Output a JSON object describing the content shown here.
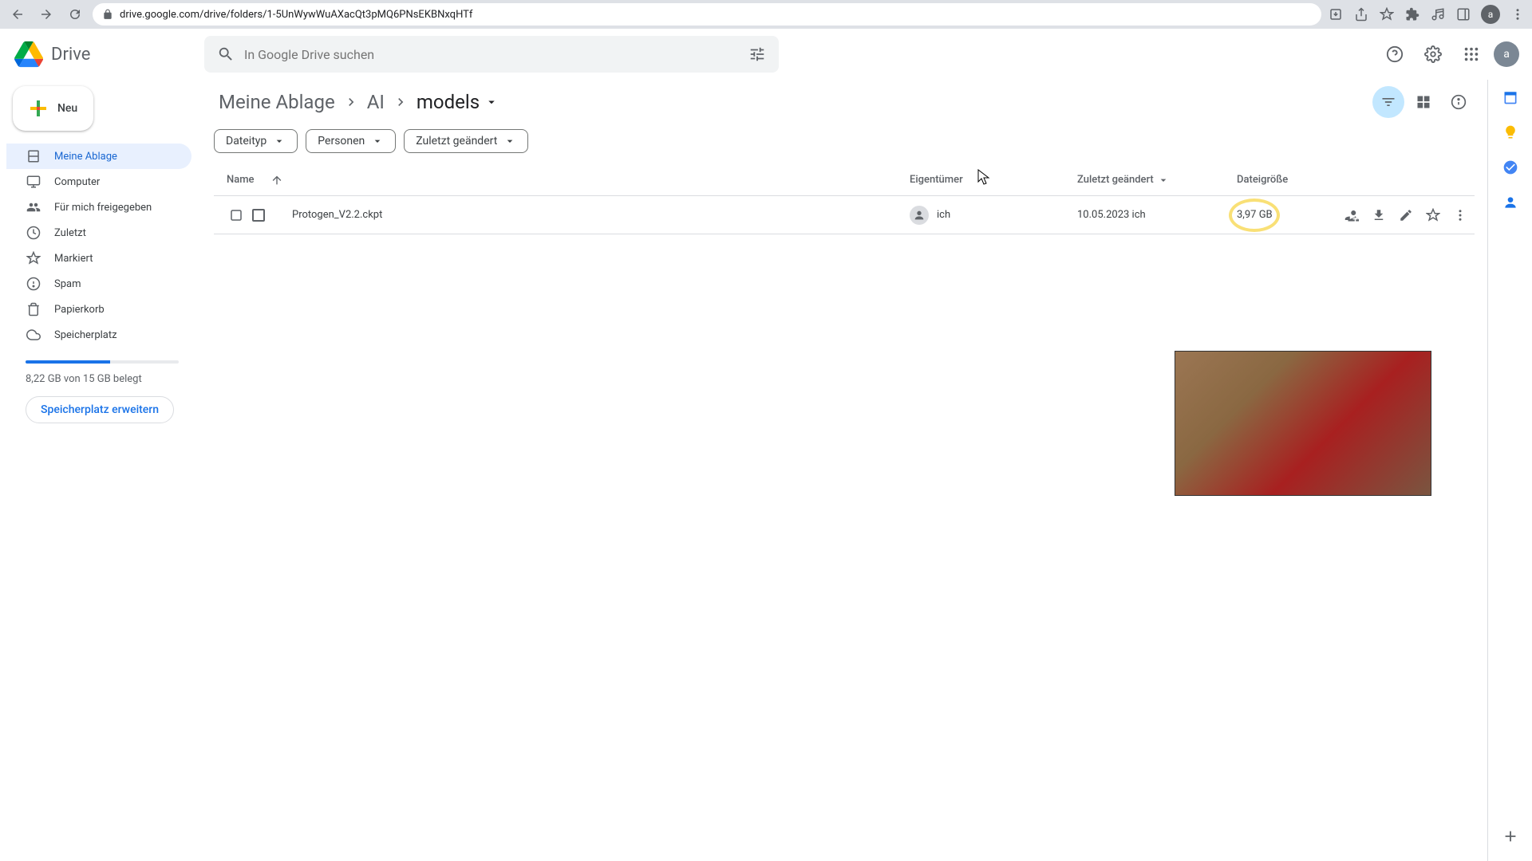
{
  "browser": {
    "url": "drive.google.com/drive/folders/1-5UnWywWuAXacQt3pMQ6PNsEKBNxqHTf"
  },
  "header": {
    "app_name": "Drive",
    "search_placeholder": "In Google Drive suchen",
    "avatar_letter": "a"
  },
  "sidebar": {
    "new_label": "Neu",
    "items": [
      {
        "label": "Meine Ablage"
      },
      {
        "label": "Computer"
      },
      {
        "label": "Für mich freigegeben"
      },
      {
        "label": "Zuletzt"
      },
      {
        "label": "Markiert"
      },
      {
        "label": "Spam"
      },
      {
        "label": "Papierkorb"
      },
      {
        "label": "Speicherplatz"
      }
    ],
    "storage_text": "8,22 GB von 15 GB belegt",
    "upgrade_label": "Speicherplatz erweitern"
  },
  "breadcrumb": {
    "items": [
      "Meine Ablage",
      "AI",
      "models"
    ]
  },
  "filters": [
    {
      "label": "Dateityp"
    },
    {
      "label": "Personen"
    },
    {
      "label": "Zuletzt geändert"
    }
  ],
  "table": {
    "headers": {
      "name": "Name",
      "owner": "Eigentümer",
      "modified": "Zuletzt geändert",
      "size": "Dateigröße"
    },
    "rows": [
      {
        "name": "Protogen_V2.2.ckpt",
        "owner": "ich",
        "modified": "10.05.2023 ich",
        "size": "3,97 GB"
      }
    ]
  }
}
